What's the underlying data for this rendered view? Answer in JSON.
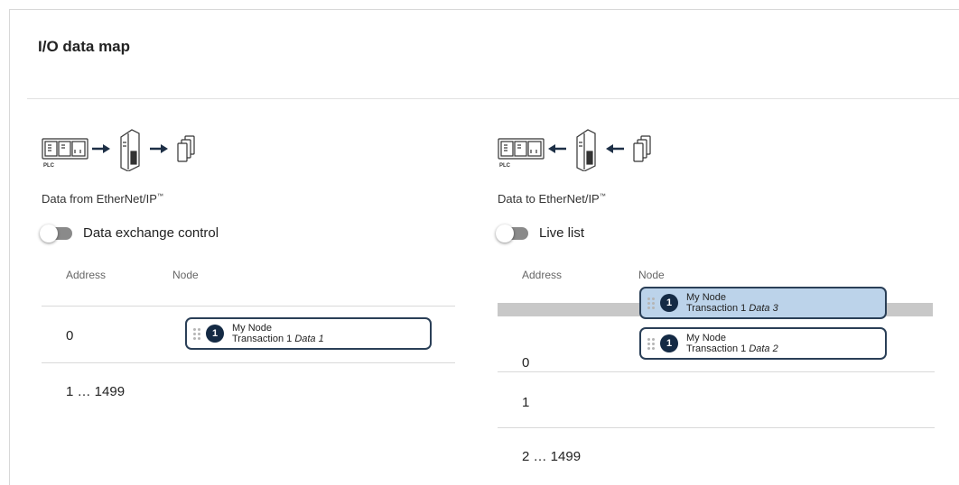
{
  "panel": {
    "title": "I/O data map"
  },
  "left": {
    "caption": "Data from EtherNet/IP",
    "caption_tm": "™",
    "toggle_label": "Data exchange control",
    "toggle_on": false,
    "columns": {
      "address": "Address",
      "node": "Node"
    },
    "rows": [
      {
        "address": "0",
        "chip": {
          "badge": "1",
          "name": "My Node",
          "transaction": "Transaction 1",
          "data": "Data 1"
        }
      },
      {
        "address": "1 … 1499"
      }
    ]
  },
  "right": {
    "caption": "Data to EtherNet/IP",
    "caption_tm": "™",
    "toggle_label": "Live list",
    "toggle_on": false,
    "columns": {
      "address": "Address",
      "node": "Node"
    },
    "dragging_chip": {
      "badge": "1",
      "name": "My Node",
      "transaction": "Transaction 1",
      "data": "Data 3"
    },
    "rows": [
      {
        "address": "0",
        "chip": {
          "badge": "1",
          "name": "My Node",
          "transaction": "Transaction 1",
          "data": "Data 2"
        }
      },
      {
        "address": "1"
      },
      {
        "address": "2 … 1499"
      }
    ]
  },
  "icons": {
    "plc": "plc-icon",
    "coupler": "coupler-icon",
    "data": "data-stack-icon",
    "arrow": "arrow-icon"
  },
  "colors": {
    "chip_border": "#2a3f57",
    "badge_bg": "#142a44",
    "drag_highlight": "#bcd3ea",
    "drop_zone": "#c8c8c8"
  }
}
